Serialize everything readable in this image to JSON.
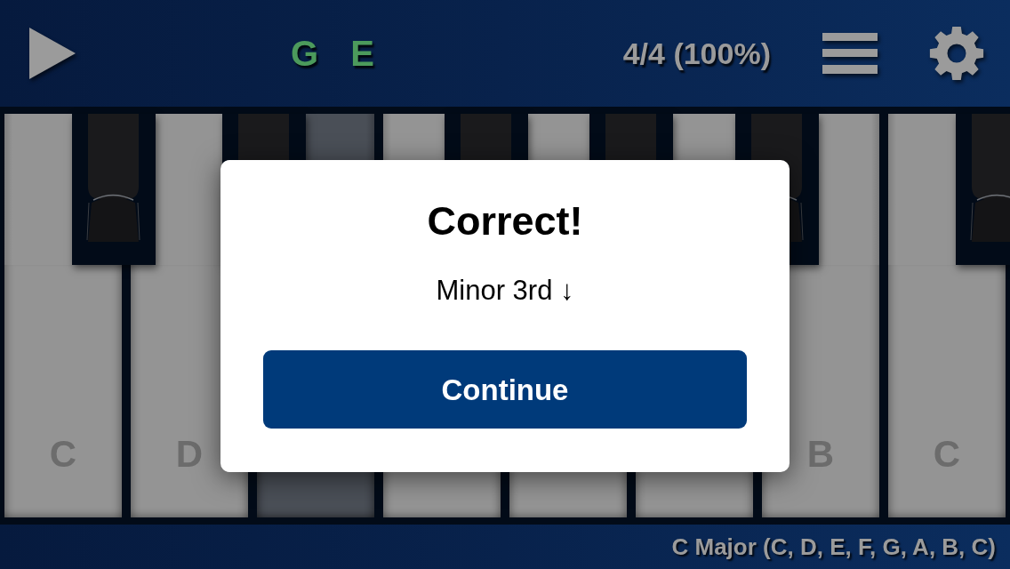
{
  "top_bar": {
    "notes": [
      {
        "label": "G",
        "correct": true
      },
      {
        "label": "E",
        "correct": true
      }
    ],
    "score": "4/4 (100%)"
  },
  "keyboard": {
    "white_keys": [
      {
        "label": "C",
        "highlighted": false,
        "sharp_after": true
      },
      {
        "label": "D",
        "highlighted": false,
        "sharp_after": true
      },
      {
        "highlighted": true,
        "sharp_after": false
      },
      {
        "highlighted": false,
        "sharp_after": true
      },
      {
        "highlighted": false,
        "sharp_after": true
      },
      {
        "highlighted": false,
        "sharp_after": true
      },
      {
        "label": "B",
        "highlighted": false,
        "sharp_after": false
      },
      {
        "label": "C",
        "highlighted": false,
        "sharp_after": true
      }
    ]
  },
  "dialog": {
    "title": "Correct!",
    "interval": "Minor 3rd ↓",
    "button": "Continue"
  },
  "scale_label": "C Major (C, D, E, F, G, A, B, C)"
}
